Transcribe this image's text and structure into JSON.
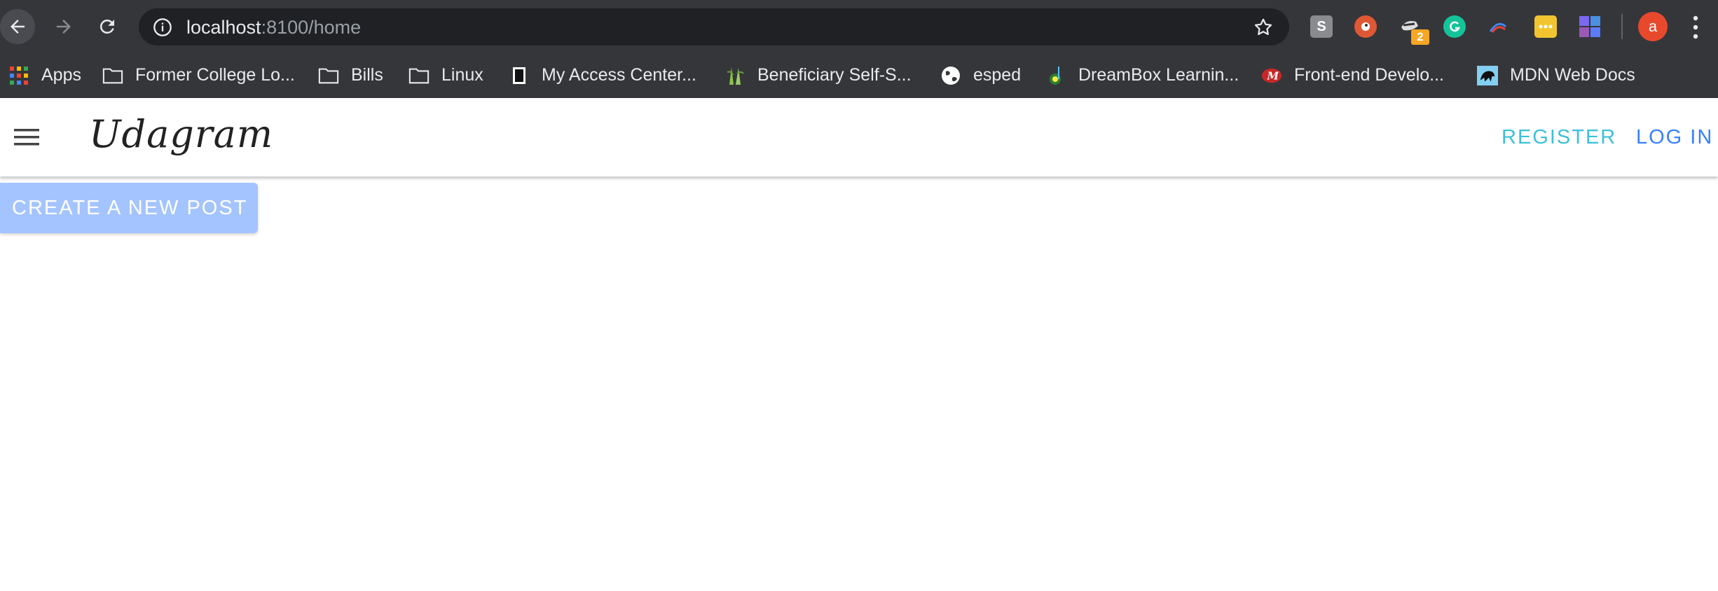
{
  "browser": {
    "url_host": "localhost",
    "url_rest": ":8100/home",
    "extension_badge": "2",
    "profile_initial": "a",
    "bookmarks": [
      {
        "label": "Apps",
        "icon": "apps-grid-icon"
      },
      {
        "label": "Former College Lo...",
        "icon": "folder-icon"
      },
      {
        "label": "Bills",
        "icon": "folder-icon"
      },
      {
        "label": "Linux",
        "icon": "folder-icon"
      },
      {
        "label": "My Access Center...",
        "icon": "document-icon"
      },
      {
        "label": "Beneficiary Self-S...",
        "icon": "beneficiary-icon"
      },
      {
        "label": "esped",
        "icon": "globe-icon"
      },
      {
        "label": "DreamBox Learnin...",
        "icon": "dreambox-icon"
      },
      {
        "label": "Front-end Develo...",
        "icon": "frontend-icon"
      },
      {
        "label": "MDN Web Docs",
        "icon": "mdn-icon"
      }
    ]
  },
  "header": {
    "brand": "Udagram",
    "register_label": "REGISTER",
    "login_label": "LOG IN"
  },
  "main": {
    "create_post_label": "CREATE A NEW POST"
  },
  "colors": {
    "chrome_bg": "#35363a",
    "omnibox_bg": "#202124",
    "register": "#3bc1d9",
    "login": "#3880ff",
    "create_button": "#a4c4ff"
  }
}
